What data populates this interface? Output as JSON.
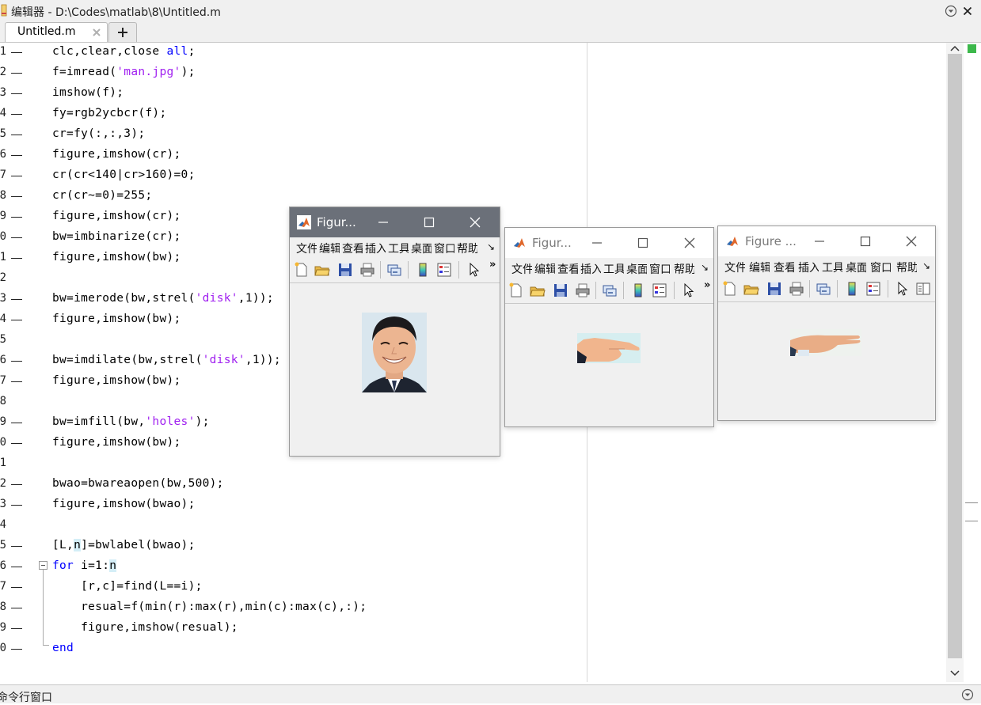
{
  "window": {
    "title": "编辑器 - D:\\Codes\\matlab\\8\\Untitled.m"
  },
  "tabs": [
    {
      "label": "Untitled.m"
    }
  ],
  "gutter": {
    "line_numbers": [
      "1",
      "2",
      "3",
      "4",
      "5",
      "6",
      "7",
      "8",
      "9",
      "0",
      "1",
      "2",
      "3",
      "4",
      "5",
      "6",
      "7",
      "8",
      "9",
      "0",
      "1",
      "2",
      "3",
      "4",
      "5",
      "6",
      "7",
      "8",
      "9",
      "0"
    ]
  },
  "code": {
    "lines": [
      {
        "parts": [
          {
            "t": "clc,clear,close "
          },
          {
            "t": "all",
            "c": "kw"
          },
          {
            "t": ";"
          }
        ]
      },
      {
        "parts": [
          {
            "t": "f=imread("
          },
          {
            "t": "'man.jpg'",
            "c": "str"
          },
          {
            "t": ");"
          }
        ]
      },
      {
        "parts": [
          {
            "t": "imshow(f);"
          }
        ]
      },
      {
        "parts": [
          {
            "t": "fy=rgb2ycbcr(f);"
          }
        ]
      },
      {
        "parts": [
          {
            "t": "cr=fy(:,:,3);"
          }
        ]
      },
      {
        "parts": [
          {
            "t": "figure,imshow(cr);"
          }
        ]
      },
      {
        "parts": [
          {
            "t": "cr(cr<140|cr>160)=0;"
          }
        ]
      },
      {
        "parts": [
          {
            "t": "cr(cr~=0)=255;"
          }
        ]
      },
      {
        "parts": [
          {
            "t": "figure,imshow(cr);"
          }
        ]
      },
      {
        "parts": [
          {
            "t": "bw=imbinarize(cr);"
          }
        ]
      },
      {
        "parts": [
          {
            "t": "figure,imshow(bw);"
          }
        ]
      },
      {
        "parts": []
      },
      {
        "parts": [
          {
            "t": "bw=imerode(bw,strel("
          },
          {
            "t": "'disk'",
            "c": "str"
          },
          {
            "t": ",1));"
          }
        ]
      },
      {
        "parts": [
          {
            "t": "figure,imshow(bw);"
          }
        ]
      },
      {
        "parts": []
      },
      {
        "parts": [
          {
            "t": "bw=imdilate(bw,strel("
          },
          {
            "t": "'disk'",
            "c": "str"
          },
          {
            "t": ",1));"
          }
        ]
      },
      {
        "parts": [
          {
            "t": "figure,imshow(bw);"
          }
        ]
      },
      {
        "parts": []
      },
      {
        "parts": [
          {
            "t": "bw=imfill(bw,"
          },
          {
            "t": "'holes'",
            "c": "str"
          },
          {
            "t": ");"
          }
        ]
      },
      {
        "parts": [
          {
            "t": "figure,imshow(bw);"
          }
        ]
      },
      {
        "parts": []
      },
      {
        "parts": [
          {
            "t": "bwao=bwareaopen(bw,500);"
          }
        ]
      },
      {
        "parts": [
          {
            "t": "figure,imshow(bwao);"
          }
        ]
      },
      {
        "parts": []
      },
      {
        "parts": [
          {
            "t": "[L,"
          },
          {
            "t": "n",
            "c": "hl"
          },
          {
            "t": "]=bwlabel(bwao);"
          }
        ]
      },
      {
        "parts": [
          {
            "t": "for",
            "c": "kw"
          },
          {
            "t": " i=1:"
          },
          {
            "t": "n",
            "c": "hl"
          }
        ]
      },
      {
        "parts": [
          {
            "t": "    [r,c]=find(L==i);"
          }
        ]
      },
      {
        "parts": [
          {
            "t": "    resual=f(min(r):max(r),min(c):max(c),:);"
          }
        ]
      },
      {
        "parts": [
          {
            "t": "    figure,imshow(resual);"
          }
        ]
      },
      {
        "parts": [
          {
            "t": "end",
            "c": "kw"
          }
        ]
      }
    ]
  },
  "command_window": {
    "title": "命令行窗口"
  },
  "figures": [
    {
      "title": "Figur...",
      "menu": [
        "文件",
        "编辑",
        "查看",
        "插入",
        "工具",
        "桌面",
        "窗口",
        "帮助"
      ],
      "menu_more": "↘",
      "toolbar_more": "»",
      "image": "face-photo"
    },
    {
      "title": "Figur...",
      "menu": [
        "文件",
        "编辑",
        "查看",
        "插入",
        "工具",
        "桌面",
        "窗口",
        "帮助"
      ],
      "menu_more": "↘",
      "toolbar_more": "»",
      "image": "pointing-hand-photo"
    },
    {
      "title": "Figure ...",
      "menu": [
        "文件",
        "编辑",
        "查看",
        "插入",
        "工具",
        "桌面",
        "窗口",
        "帮助"
      ],
      "menu_more": "↘",
      "toolbar_more": "",
      "image": "open-palm-photo"
    }
  ],
  "colors": {
    "keyword": "#0000ff",
    "string": "#a020f0",
    "highlight": "#d4eef7",
    "active_titlebar": "#6b7079",
    "status_ok": "#3cb84b"
  }
}
